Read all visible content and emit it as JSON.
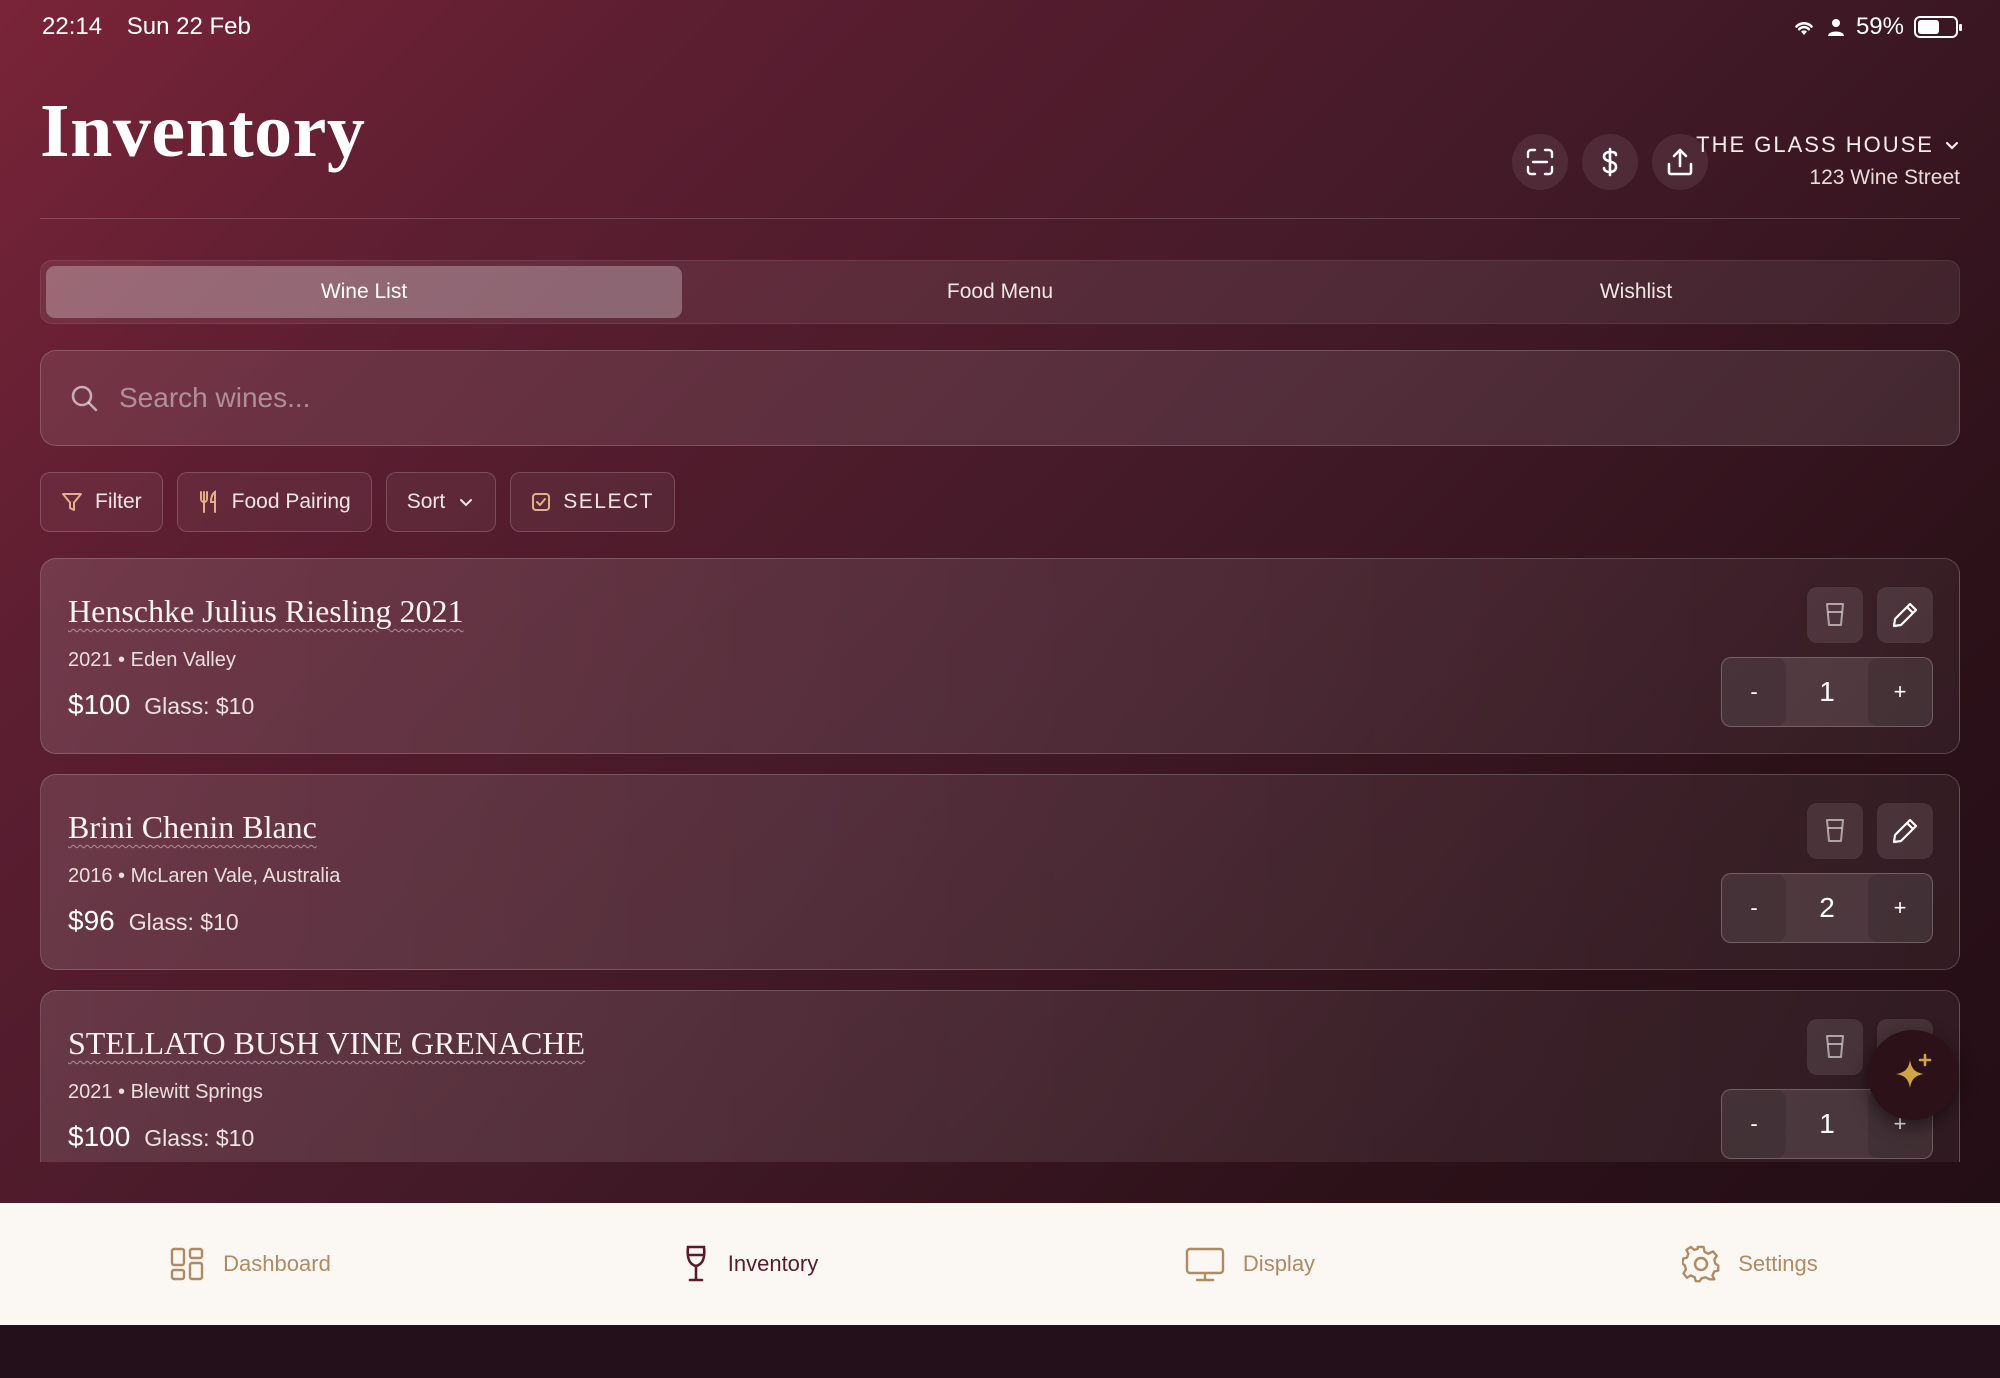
{
  "status_bar": {
    "time": "22:14",
    "date": "Sun 22 Feb",
    "battery": "59%",
    "battery_level": 0.59
  },
  "header": {
    "title": "Inventory",
    "venue_name": "THE GLASS HOUSE",
    "venue_address": "123 Wine Street",
    "action_icons": [
      "scan-icon",
      "dollar-icon",
      "upload-icon"
    ]
  },
  "tabs": [
    {
      "label": "Wine List",
      "active": true
    },
    {
      "label": "Food Menu",
      "active": false
    },
    {
      "label": "Wishlist",
      "active": false
    }
  ],
  "search": {
    "placeholder": "Search wines...",
    "value": ""
  },
  "filters": {
    "filter_label": "Filter",
    "food_pairing_label": "Food Pairing",
    "sort_label": "Sort",
    "select_label": "SELECT"
  },
  "wines": [
    {
      "name": "Henschke Julius Riesling 2021",
      "meta": "2021 • Eden Valley",
      "price": "$100",
      "glass": "Glass: $10",
      "quantity": "1"
    },
    {
      "name": "Brini Chenin Blanc",
      "meta": "2016 • McLaren Vale, Australia",
      "price": "$96",
      "glass": "Glass: $10",
      "quantity": "2"
    },
    {
      "name": "STELLATO BUSH VINE GRENACHE",
      "meta": "2021 • Blewitt Springs",
      "price": "$100",
      "glass": "Glass: $10",
      "quantity": "1"
    }
  ],
  "stepper": {
    "minus": "-",
    "plus": "+"
  },
  "bottom_nav": [
    {
      "label": "Dashboard",
      "icon": "grid-icon",
      "active": false
    },
    {
      "label": "Inventory",
      "icon": "wine-glass-icon",
      "active": true
    },
    {
      "label": "Display",
      "icon": "monitor-icon",
      "active": false
    },
    {
      "label": "Settings",
      "icon": "gear-icon",
      "active": false
    }
  ],
  "colors": {
    "accent_gold": "#d1a445",
    "nav_inactive": "#b08a62",
    "nav_active": "#5a1a2e",
    "background_wine": "#5c1e31"
  }
}
